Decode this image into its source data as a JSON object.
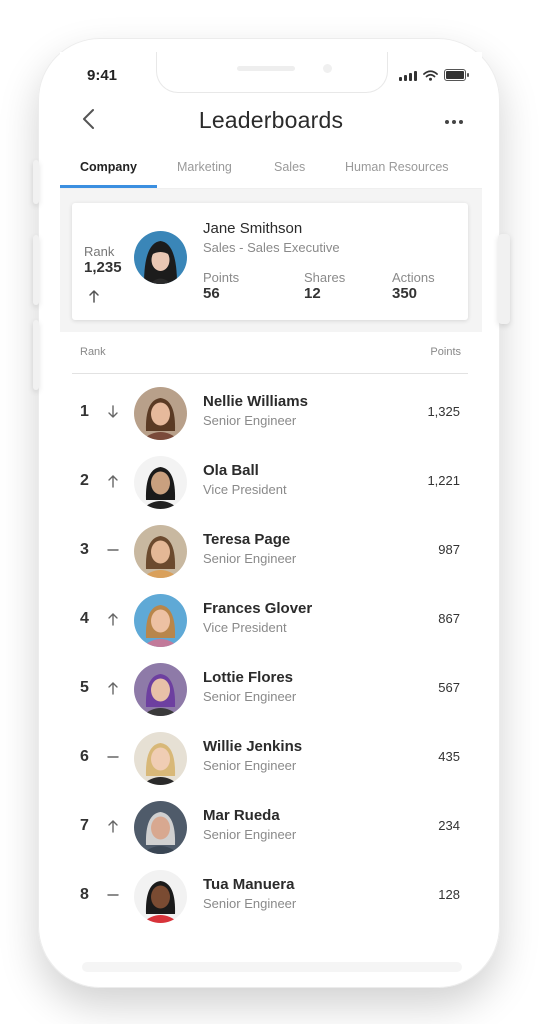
{
  "status": {
    "time": "9:41"
  },
  "header": {
    "title": "Leaderboards"
  },
  "tabs": [
    {
      "label": "Company",
      "active": true
    },
    {
      "label": "Marketing",
      "active": false
    },
    {
      "label": "Sales",
      "active": false
    },
    {
      "label": "Human Resources",
      "active": false
    }
  ],
  "summary": {
    "rank_label": "Rank",
    "rank_value": "1,235",
    "rank_trend": "up-arrow-icon",
    "name": "Jane Smithson",
    "role": "Sales - Sales Executive",
    "stats": [
      {
        "label": "Points",
        "value": "56"
      },
      {
        "label": "Shares",
        "value": "12"
      },
      {
        "label": "Actions",
        "value": "350"
      }
    ]
  },
  "list": {
    "rank_header": "Rank",
    "points_header": "Points",
    "rows": [
      {
        "rank": "1",
        "trend": "down",
        "name": "Nellie Williams",
        "title": "Senior Engineer",
        "points": "1,325"
      },
      {
        "rank": "2",
        "trend": "up",
        "name": "Ola Ball",
        "title": "Vice President",
        "points": "1,221"
      },
      {
        "rank": "3",
        "trend": "same",
        "name": "Teresa Page",
        "title": "Senior Engineer",
        "points": "987"
      },
      {
        "rank": "4",
        "trend": "up",
        "name": "Frances Glover",
        "title": "Vice President",
        "points": "867"
      },
      {
        "rank": "5",
        "trend": "up",
        "name": "Lottie Flores",
        "title": "Senior Engineer",
        "points": "567"
      },
      {
        "rank": "6",
        "trend": "same",
        "name": "Willie Jenkins",
        "title": "Senior Engineer",
        "points": "435"
      },
      {
        "rank": "7",
        "trend": "up",
        "name": "Mar Rueda",
        "title": "Senior Engineer",
        "points": "234"
      },
      {
        "rank": "8",
        "trend": "same",
        "name": "Tua Manuera",
        "title": "Senior Engineer",
        "points": "128"
      }
    ]
  },
  "colors": {
    "accent": "#3b8fe0"
  }
}
